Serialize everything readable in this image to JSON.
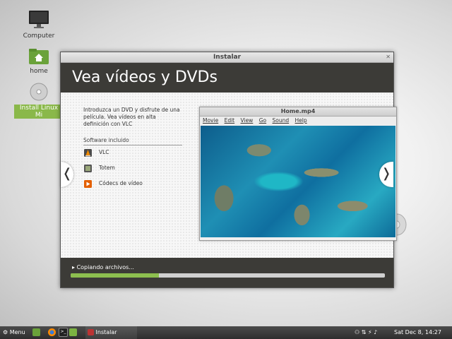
{
  "desktop": {
    "icons": [
      {
        "label": "Computer"
      },
      {
        "label": "home"
      },
      {
        "label": "Install Linux Mi"
      }
    ]
  },
  "window": {
    "title": "Instalar",
    "header": "Vea vídeos y DVDs",
    "description": "Introduzca un DVD y disfrute de una película. Vea vídeos en alta definición con VLC",
    "software_heading": "Software incluido",
    "software": [
      {
        "label": "VLC",
        "icon": "vlc-cone-icon",
        "color": "#e67e00"
      },
      {
        "label": "Totem",
        "icon": "totem-film-icon",
        "color": "#6b7a55"
      },
      {
        "label": "Códecs de vídeo",
        "icon": "codecs-icon",
        "color": "#e35f00"
      }
    ],
    "nav_prev": "❬",
    "nav_next": "❭",
    "status": "Copiando archivos...",
    "progress": 0.28
  },
  "vlc": {
    "title": "Home.mp4",
    "menu": [
      "Movie",
      "Edit",
      "View",
      "Go",
      "Sound",
      "Help"
    ]
  },
  "taskbar": {
    "menu_label": "Menu",
    "task_label": "Instalar",
    "clock": "Sat Dec  8, 14:27"
  },
  "colors": {
    "accent": "#8dbf4f",
    "dark_header": "#3c3b37"
  }
}
